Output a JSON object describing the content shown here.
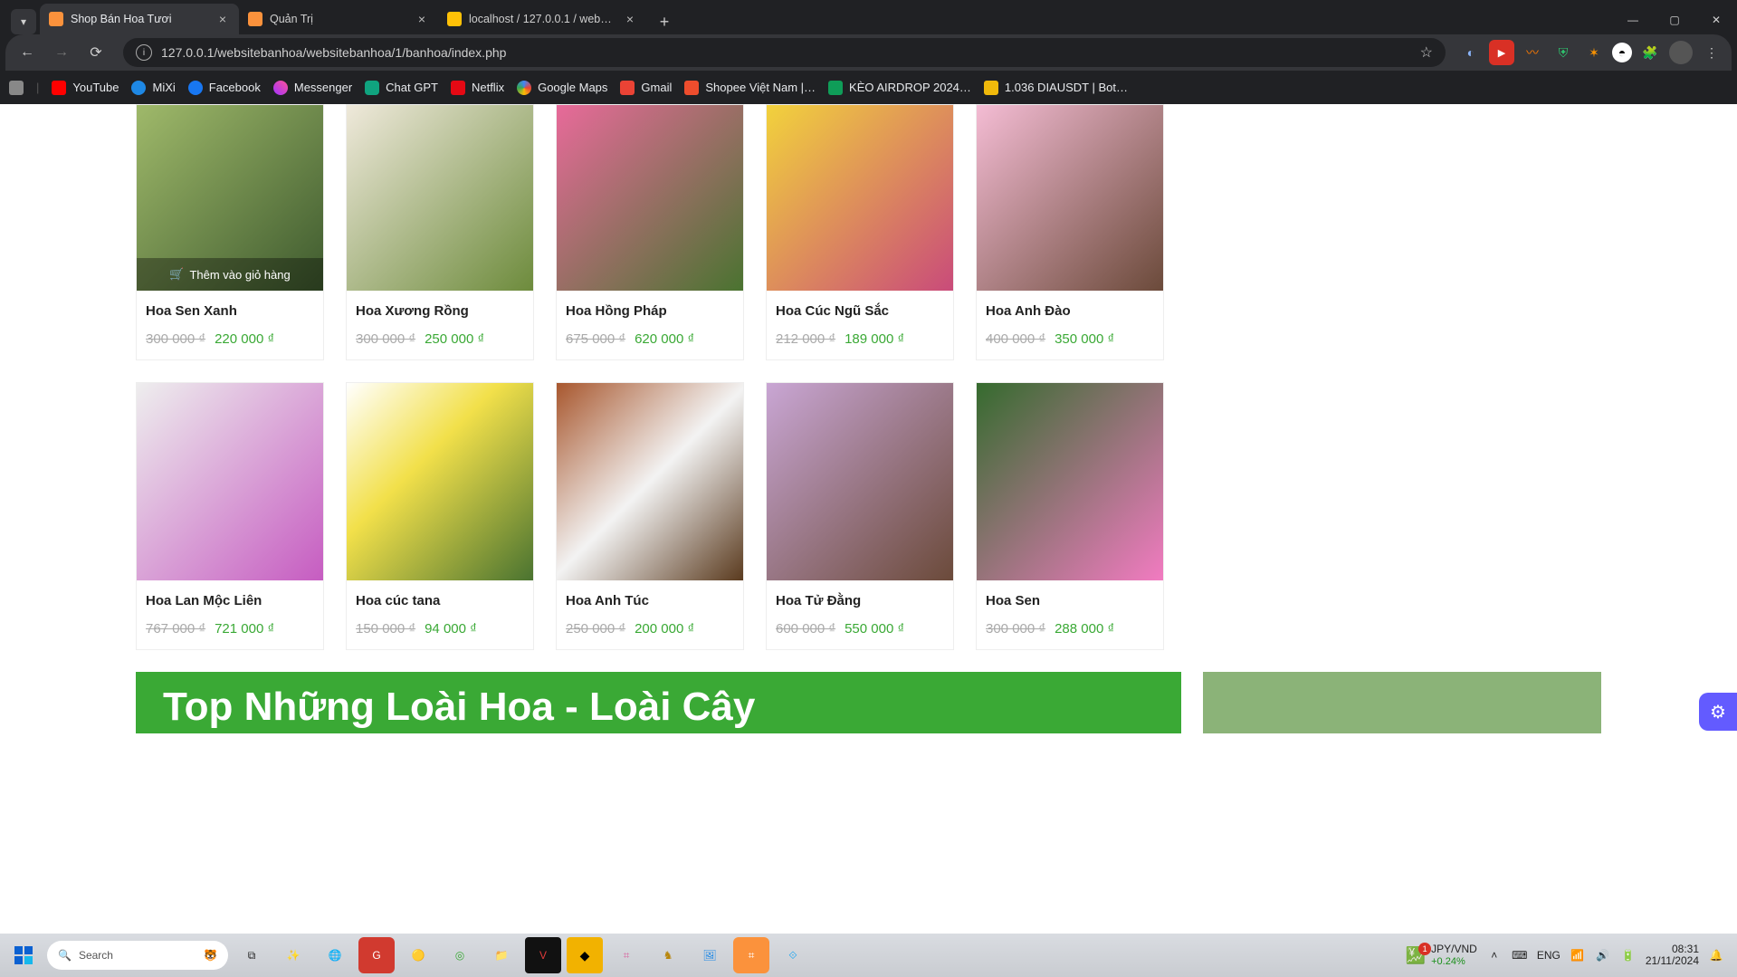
{
  "browser": {
    "tabs": [
      {
        "title": "Shop Bán Hoa Tươi",
        "active": true
      },
      {
        "title": "Quản Trị",
        "active": false
      },
      {
        "title": "localhost / 127.0.0.1 / webbanh",
        "active": false
      }
    ],
    "url": "127.0.0.1/websitebanhoa/websitebanhoa/1/banhoa/index.php",
    "bookmarks": [
      {
        "label": "YouTube",
        "color": "#ff0000"
      },
      {
        "label": "MiXi",
        "color": "#1e88e5"
      },
      {
        "label": "Facebook",
        "color": "#1877f2"
      },
      {
        "label": "Messenger",
        "color": "#a033ff"
      },
      {
        "label": "Chat GPT",
        "color": "#10a37f"
      },
      {
        "label": "Netflix",
        "color": "#e50914"
      },
      {
        "label": "Google Maps",
        "color": "#34a853"
      },
      {
        "label": "Gmail",
        "color": "#ea4335"
      },
      {
        "label": "Shopee Việt Nam |…",
        "color": "#ee4d2d"
      },
      {
        "label": "KÈO AIRDROP 2024…",
        "color": "#0f9d58"
      },
      {
        "label": "1.036 DIAUSDT | Bot…",
        "color": "#f0b90b"
      }
    ]
  },
  "products": [
    {
      "name": "Hoa Sen Xanh",
      "old": "300 000 ₫",
      "new": "220 000 ₫"
    },
    {
      "name": "Hoa Xương Rồng",
      "old": "300 000 ₫",
      "new": "250 000 ₫"
    },
    {
      "name": "Hoa Hồng Pháp",
      "old": "675 000 ₫",
      "new": "620 000 ₫"
    },
    {
      "name": "Hoa Cúc Ngũ Sắc",
      "old": "212 000 ₫",
      "new": "189 000 ₫"
    },
    {
      "name": "Hoa Anh Đào",
      "old": "400 000 ₫",
      "new": "350 000 ₫"
    },
    {
      "name": "Hoa Lan Mộc Liên",
      "old": "767 000 ₫",
      "new": "721 000 ₫"
    },
    {
      "name": "Hoa cúc tana",
      "old": "150 000 ₫",
      "new": "94 000 ₫"
    },
    {
      "name": "Hoa Anh Túc",
      "old": "250 000 ₫",
      "new": "200 000 ₫"
    },
    {
      "name": "Hoa Tử Đằng",
      "old": "600 000 ₫",
      "new": "550 000 ₫"
    },
    {
      "name": "Hoa Sen",
      "old": "300 000 ₫",
      "new": "288 000 ₫"
    }
  ],
  "add_to_cart_label": "Thêm vào giỏ hàng",
  "banner_title": "Top Những Loài Hoa - Loài Cây",
  "taskbar": {
    "search_placeholder": "Search",
    "stock_pair": "JPY/VND",
    "stock_change": "+0.24%",
    "stock_badge": "1",
    "lang": "ENG",
    "time": "08:31",
    "date": "21/11/2024"
  }
}
